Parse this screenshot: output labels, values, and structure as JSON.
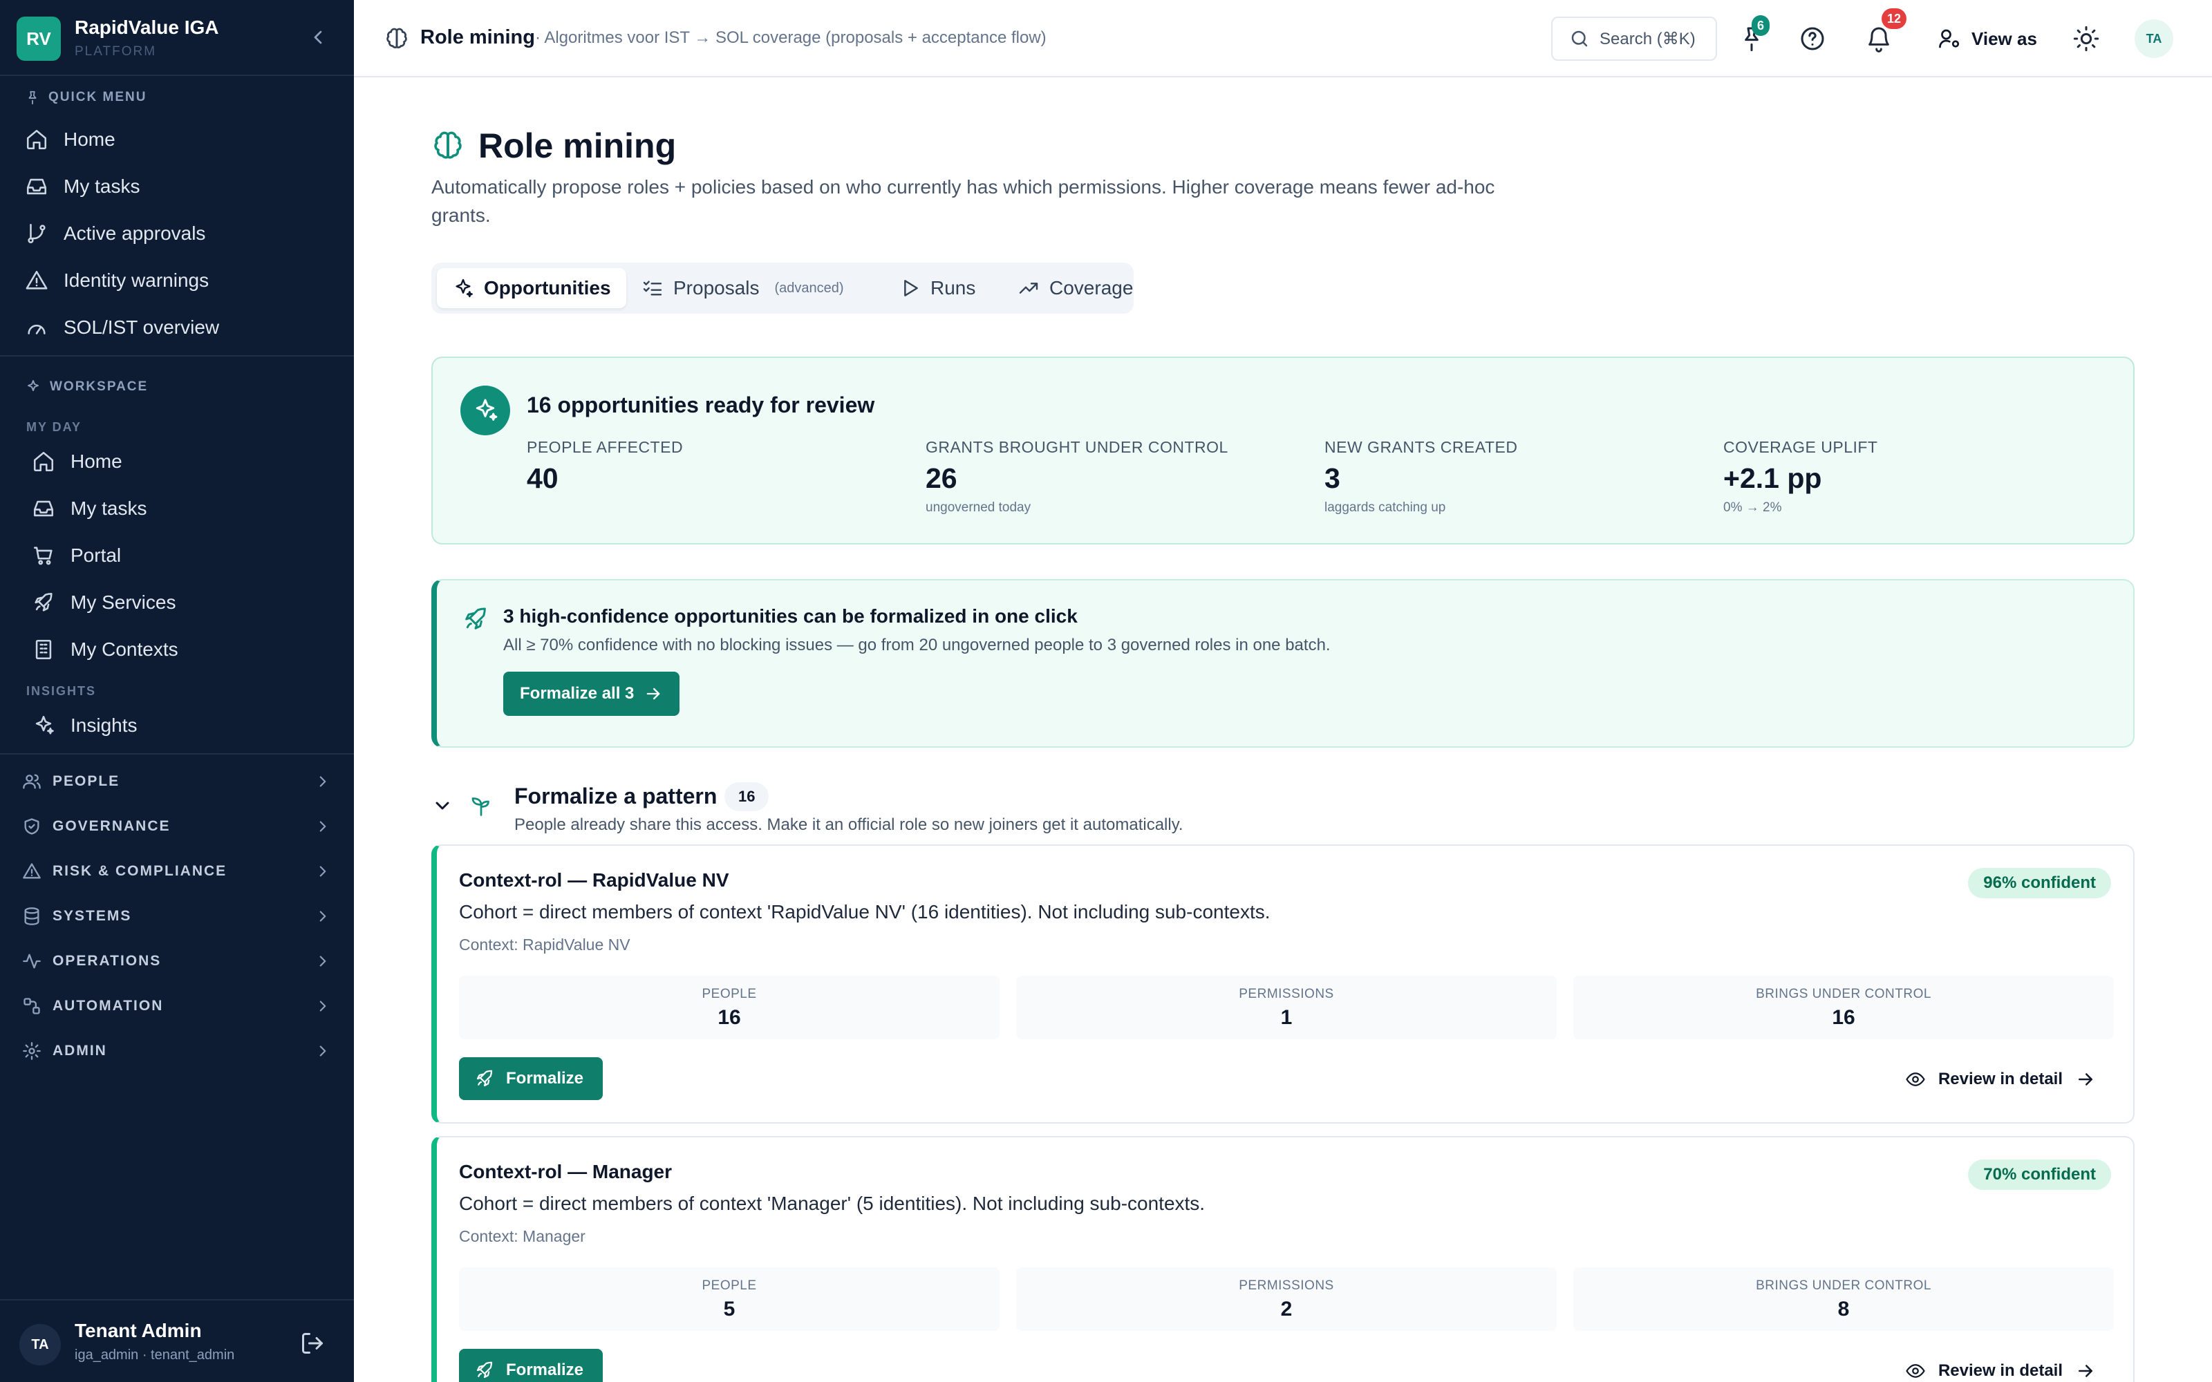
{
  "app": {
    "logo": "RV",
    "name": "RapidValue IGA",
    "subtitle": "PLATFORM"
  },
  "sidebar": {
    "quick_menu_label": "QUICK MENU",
    "quick_items": [
      {
        "label": "Home",
        "icon": "home-icon"
      },
      {
        "label": "My tasks",
        "icon": "inbox-icon"
      },
      {
        "label": "Active approvals",
        "icon": "git-branch-icon"
      },
      {
        "label": "Identity warnings",
        "icon": "warning-icon"
      },
      {
        "label": "SOL/IST overview",
        "icon": "gauge-icon"
      }
    ],
    "workspace_label": "WORKSPACE",
    "my_day_label": "MY DAY",
    "my_day_items": [
      {
        "label": "Home",
        "icon": "home-icon"
      },
      {
        "label": "My tasks",
        "icon": "inbox-icon"
      },
      {
        "label": "Portal",
        "icon": "cart-icon"
      },
      {
        "label": "My Services",
        "icon": "rocket-icon"
      },
      {
        "label": "My Contexts",
        "icon": "building-icon"
      }
    ],
    "insights_label": "INSIGHTS",
    "insights_items": [
      {
        "label": "Insights",
        "icon": "sparkles-icon"
      }
    ],
    "groups": [
      {
        "label": "PEOPLE",
        "icon": "users-icon"
      },
      {
        "label": "GOVERNANCE",
        "icon": "shield-icon"
      },
      {
        "label": "RISK & COMPLIANCE",
        "icon": "warning-icon"
      },
      {
        "label": "SYSTEMS",
        "icon": "database-icon"
      },
      {
        "label": "OPERATIONS",
        "icon": "activity-icon"
      },
      {
        "label": "AUTOMATION",
        "icon": "workflow-icon"
      },
      {
        "label": "ADMIN",
        "icon": "gear-icon"
      }
    ],
    "user": {
      "initials": "TA",
      "name": "Tenant Admin",
      "roles": "iga_admin · tenant_admin"
    }
  },
  "topbar": {
    "title": "Role mining",
    "subtitle": "· Algoritmes voor IST → SOL coverage (proposals + acceptance flow)",
    "search_label": "Search (⌘K)",
    "pins_count": "6",
    "notifications_count": "12",
    "view_as_label": "View as",
    "avatar": "TA"
  },
  "page": {
    "title": "Role mining",
    "description": "Automatically propose roles + policies based on who currently has which permissions. Higher coverage means fewer ad-hoc grants.",
    "tabs": [
      {
        "label": "Opportunities",
        "active": true
      },
      {
        "label": "Proposals",
        "extra": "(advanced)"
      },
      {
        "label": "Runs"
      },
      {
        "label": "Coverage"
      }
    ]
  },
  "summary": {
    "title": "16 opportunities ready for review",
    "stats": [
      {
        "label": "PEOPLE AFFECTED",
        "value": "40",
        "hint": ""
      },
      {
        "label": "GRANTS BROUGHT UNDER CONTROL",
        "value": "26",
        "hint": "ungoverned today"
      },
      {
        "label": "NEW GRANTS CREATED",
        "value": "3",
        "hint": "laggards catching up"
      },
      {
        "label": "COVERAGE UPLIFT",
        "value": "+2.1 pp",
        "hint": "0% → 2%"
      }
    ]
  },
  "cta": {
    "title": "3 high-confidence opportunities can be formalized in one click",
    "description": "All ≥ 70% confidence with no blocking issues — go from 20 ungoverned people to 3 governed roles in one batch.",
    "button": "Formalize all 3"
  },
  "pattern": {
    "title": "Formalize a pattern",
    "count": "16",
    "description": "People already share this access. Make it an official role so new joiners get it automatically."
  },
  "cards": [
    {
      "title": "Context-rol — RapidValue NV",
      "description": "Cohort = direct members of context 'RapidValue NV' (16 identities). Not including sub-contexts.",
      "context": "Context: RapidValue NV",
      "confidence": "96% confident",
      "metrics": [
        {
          "label": "PEOPLE",
          "value": "16"
        },
        {
          "label": "PERMISSIONS",
          "value": "1"
        },
        {
          "label": "BRINGS UNDER CONTROL",
          "value": "16"
        }
      ],
      "formalize": "Formalize",
      "review": "Review in detail"
    },
    {
      "title": "Context-rol — Manager",
      "description": "Cohort = direct members of context 'Manager' (5 identities). Not including sub-contexts.",
      "context": "Context: Manager",
      "confidence": "70% confident",
      "metrics": [
        {
          "label": "PEOPLE",
          "value": "5"
        },
        {
          "label": "PERMISSIONS",
          "value": "2"
        },
        {
          "label": "BRINGS UNDER CONTROL",
          "value": "8"
        }
      ],
      "formalize": "Formalize",
      "review": "Review in detail"
    }
  ]
}
